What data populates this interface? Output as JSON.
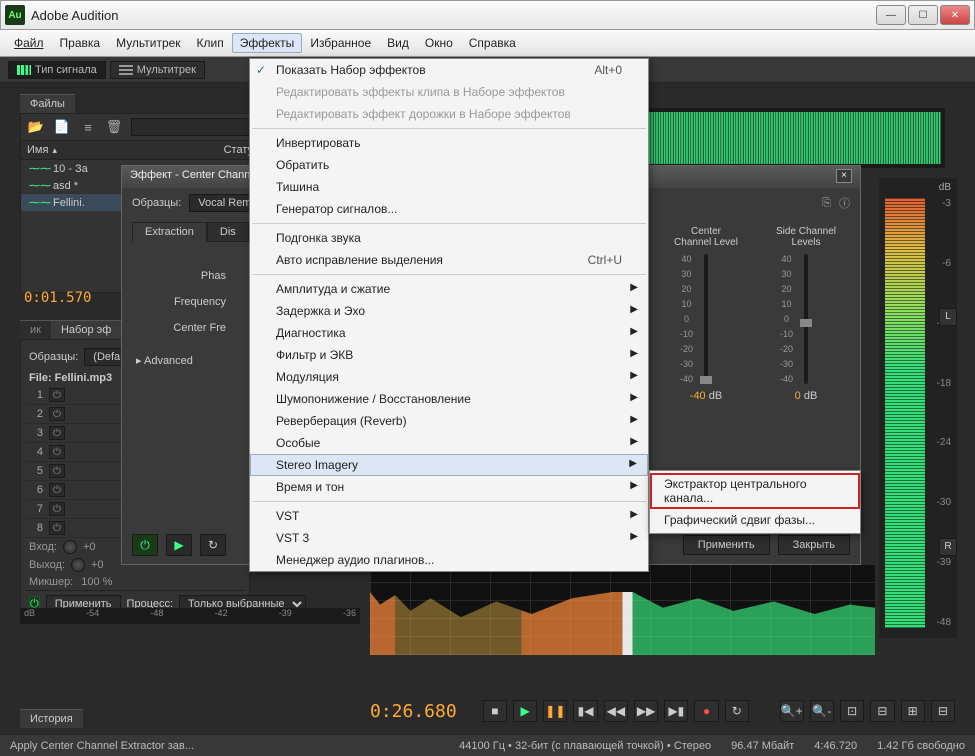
{
  "window": {
    "title": "Adobe Audition",
    "app_icon_text": "Au"
  },
  "menubar": [
    "Файл",
    "Правка",
    "Мультитрек",
    "Клип",
    "Эффекты",
    "Избранное",
    "Вид",
    "Окно",
    "Справка"
  ],
  "toolbar": {
    "signal_tab": "Тип сигнала",
    "multitrack_tab": "Мультитрек"
  },
  "files_panel": {
    "tab": "Файлы",
    "col_name": "Имя",
    "col_status": "Стату",
    "rows": [
      {
        "name": "10 - За",
        "modified": false
      },
      {
        "name": "asd *",
        "modified": true
      },
      {
        "name": "Fellini.",
        "modified": false,
        "selected": true
      }
    ]
  },
  "timecode_left": "0:01.570",
  "effects_menu": {
    "items": [
      {
        "label": "Показать Набор эффектов",
        "shortcut": "Alt+0",
        "checked": true
      },
      {
        "label": "Редактировать эффекты клипа в Наборе эффектов",
        "disabled": true
      },
      {
        "label": "Редактировать эффект дорожки в Наборе эффектов",
        "disabled": true
      },
      {
        "sep": true
      },
      {
        "label": "Инвертировать"
      },
      {
        "label": "Обратить"
      },
      {
        "label": "Тишина"
      },
      {
        "label": "Генератор сигналов..."
      },
      {
        "sep": true
      },
      {
        "label": "Подгонка звука"
      },
      {
        "label": "Авто исправление выделения",
        "shortcut": "Ctrl+U"
      },
      {
        "sep": true
      },
      {
        "label": "Амплитуда и сжатие",
        "submenu": true
      },
      {
        "label": "Задержка и Эхо",
        "submenu": true
      },
      {
        "label": "Диагностика",
        "submenu": true
      },
      {
        "label": "Фильтр и ЭКВ",
        "submenu": true
      },
      {
        "label": "Модуляция",
        "submenu": true
      },
      {
        "label": "Шумопонижение / Восстановление",
        "submenu": true
      },
      {
        "label": "Реверберация (Reverb)",
        "submenu": true
      },
      {
        "label": "Особые",
        "submenu": true
      },
      {
        "label": "Stereo Imagery",
        "submenu": true,
        "highlight": true
      },
      {
        "label": "Время и тон",
        "submenu": true
      },
      {
        "sep": true
      },
      {
        "label": "VST",
        "submenu": true
      },
      {
        "label": "VST 3",
        "submenu": true
      },
      {
        "label": "Менеджер аудио плагинов..."
      }
    ]
  },
  "stereo_submenu": {
    "items": [
      {
        "label": "Экстрактор центрального канала...",
        "redbox": true
      },
      {
        "label": "Графический сдвиг фазы..."
      }
    ]
  },
  "fx_dialog": {
    "title": "Эффект - Center Chann",
    "preset_label": "Образцы:",
    "preset_value": "Vocal Rem",
    "tabs": [
      "Extraction",
      "Dis"
    ],
    "field_phase": "Phas",
    "field_freq": "Frequency",
    "field_center_freq": "Center Fre",
    "advanced": "Advanced",
    "slider1": {
      "title1": "Center",
      "title2": "Channel Level",
      "value": "-40",
      "unit": "dB"
    },
    "slider2": {
      "title1": "Side Channel",
      "title2": "Levels",
      "value": "0",
      "unit": "dB"
    },
    "ticks": [
      "40",
      "30",
      "20",
      "10",
      "0",
      "-10",
      "-20",
      "-30",
      "-40"
    ],
    "btn_apply": "Применить",
    "btn_close": "Закрыть"
  },
  "rack": {
    "tab_left_hidden": "ик",
    "tab": "Набор эф",
    "preset_label": "Образцы:",
    "preset_value": "(Defa",
    "file_label": "File: Fellini.mp3",
    "slots": 8,
    "io_in": "Вход:",
    "io_out": "Выход:",
    "io_val": "+0",
    "mix": "Микшер:",
    "mix_val": "100 %",
    "btn_apply": "Применить",
    "process_label": "Процесс:",
    "process_value": "Только выбранные"
  },
  "hlevel_ticks": [
    "dB",
    "-54",
    "-48",
    "-42",
    "-39",
    "-36"
  ],
  "meter": {
    "db_label": "dB",
    "scale": [
      "-3",
      "-6",
      "-12",
      "-18",
      "-24",
      "-30",
      "-39",
      "-48"
    ],
    "L": "L",
    "R": "R"
  },
  "transport": {
    "time": "0:26.680"
  },
  "history": {
    "tab": "История"
  },
  "statusbar": {
    "action": "Apply Center Channel Extractor зав...",
    "sr": "44100 Гц",
    "bit": "32-бит (с плавающей точкой)",
    "ch": "Стерео",
    "size": "96.47 Мбайт",
    "dur": "4:46.720",
    "free": "1.42 Гб свободно"
  }
}
